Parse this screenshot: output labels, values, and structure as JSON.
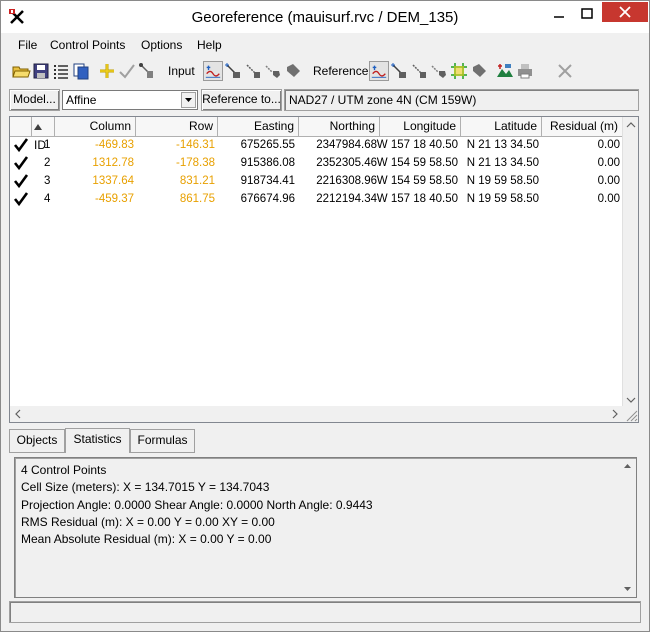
{
  "window": {
    "title": "Georeference (mauisurf.rvc / DEM_135)"
  },
  "menu": [
    "File",
    "Control Points",
    "Options",
    "Help"
  ],
  "toolbar": {
    "input_label": "Input",
    "reference_label": "Reference"
  },
  "model": {
    "button_label": "Model...",
    "selected": "Affine",
    "reference_button": "Reference to...",
    "crs": "NAD27 / UTM zone 4N (CM 159W)"
  },
  "table": {
    "headers": [
      "ID",
      "Column",
      "Row",
      "Easting",
      "Northing",
      "Longitude",
      "Latitude",
      "Residual (m)"
    ],
    "rows": [
      {
        "id": "1",
        "column": "-469.83",
        "row": "-146.31",
        "easting": "675265.55",
        "northing": "2347984.68",
        "longitude": "W 157 18 40.50",
        "latitude": "N 21 13 34.50",
        "residual": "0.00"
      },
      {
        "id": "2",
        "column": "1312.78",
        "row": "-178.38",
        "easting": "915386.08",
        "northing": "2352305.46",
        "longitude": "W 154 59 58.50",
        "latitude": "N 21 13 34.50",
        "residual": "0.00"
      },
      {
        "id": "3",
        "column": "1337.64",
        "row": "831.21",
        "easting": "918734.41",
        "northing": "2216308.96",
        "longitude": "W 154 59 58.50",
        "latitude": "N 19 59 58.50",
        "residual": "0.00"
      },
      {
        "id": "4",
        "column": "-459.37",
        "row": "861.75",
        "easting": "676674.96",
        "northing": "2212194.34",
        "longitude": "W 157 18 40.50",
        "latitude": "N 19 59 58.50",
        "residual": "0.00"
      }
    ]
  },
  "tabs": [
    "Objects",
    "Statistics",
    "Formulas"
  ],
  "statistics": [
    "4 Control Points",
    "Cell Size (meters):  X = 134.7015  Y = 134.7043",
    "Projection Angle: 0.0000  Shear Angle: 0.0000  North Angle: 0.9443",
    "RMS Residual (m):  X = 0.00  Y = 0.00  XY = 0.00",
    "Mean Absolute Residual (m):  X = 0.00  Y = 0.00"
  ],
  "colors": {
    "column_row_text": "#e8a000",
    "close_button": "#c7372f"
  }
}
